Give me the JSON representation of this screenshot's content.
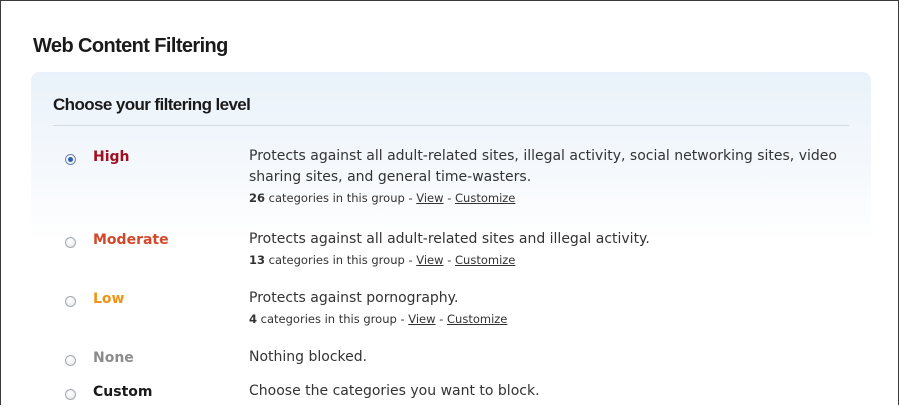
{
  "page": {
    "title": "Web Content Filtering"
  },
  "panel": {
    "heading": "Choose your filtering level"
  },
  "levels": [
    {
      "name": "High",
      "color": "#a30e1e",
      "checked": true,
      "description": "Protects against all adult-related sites, illegal activity, social networking sites, video sharing sites, and general time-wasters.",
      "count": "26",
      "count_suffix": "categories in this group -",
      "view_label": "View",
      "separator": "-",
      "customize_label": "Customize"
    },
    {
      "name": "Moderate",
      "color": "#d2482a",
      "checked": false,
      "description": "Protects against all adult-related sites and illegal activity.",
      "count": "13",
      "count_suffix": "categories in this group -",
      "view_label": "View",
      "separator": "-",
      "customize_label": "Customize"
    },
    {
      "name": "Low",
      "color": "#ef9317",
      "checked": false,
      "description": "Protects against pornography.",
      "count": "4",
      "count_suffix": "categories in this group -",
      "view_label": "View",
      "separator": "-",
      "customize_label": "Customize"
    },
    {
      "name": "None",
      "color": "#8c8c8c",
      "checked": false,
      "description": "Nothing blocked."
    },
    {
      "name": "Custom",
      "color": "#1a1a1a",
      "checked": false,
      "description": "Choose the categories you want to block."
    }
  ]
}
